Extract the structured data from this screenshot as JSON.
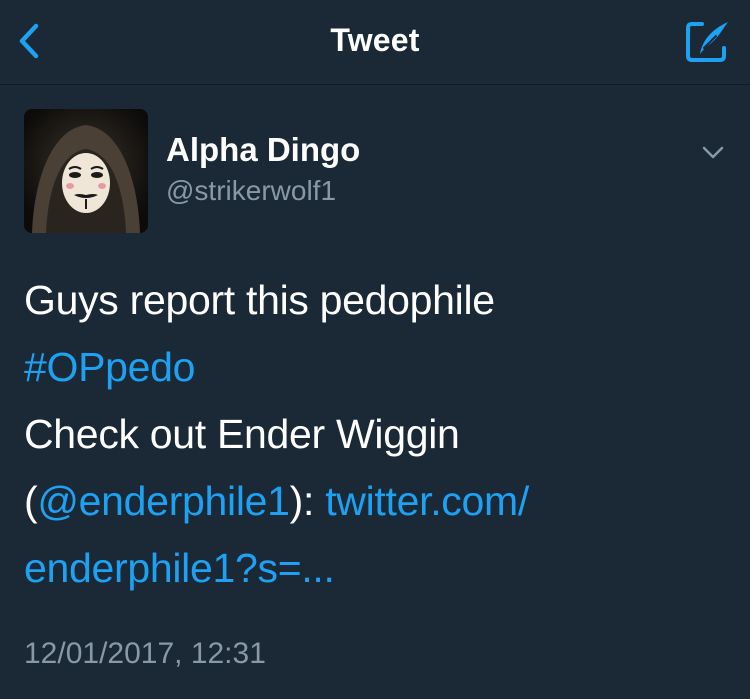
{
  "header": {
    "title": "Tweet",
    "back_icon": "chevron-left-icon",
    "compose_icon": "compose-tweet-icon",
    "accent_color": "#1da1f2"
  },
  "tweet": {
    "author": {
      "name": "Alpha Dingo",
      "handle": "@strikerwolf1",
      "avatar_icon": "masked-person-avatar"
    },
    "menu_icon": "chevron-down-icon",
    "body": {
      "line1": "Guys report this pedophile",
      "hashtag": "#OPpedo",
      "line3": "Check out Ender Wiggin",
      "paren_open": "(",
      "mention": "@enderphile1",
      "paren_close": "): ",
      "link_part1": "twitter.com/",
      "link_part2": "enderphile1?s=..."
    },
    "timestamp": "12/01/2017, 12:31"
  },
  "colors": {
    "background": "#1b2836",
    "text": "#ffffff",
    "secondary_text": "#8899a6",
    "link": "#1da1f2"
  }
}
